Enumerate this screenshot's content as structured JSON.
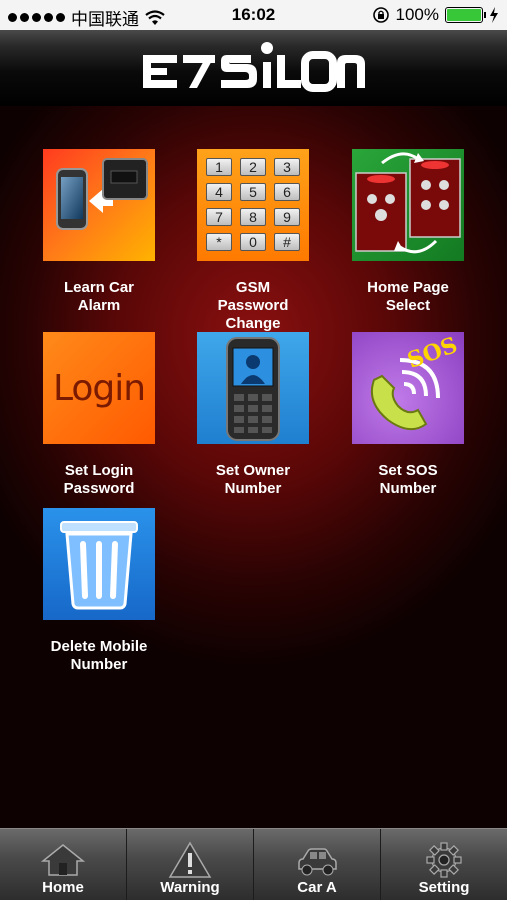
{
  "status_bar": {
    "carrier": "中国联通",
    "time": "16:02",
    "battery": "100%"
  },
  "header": {
    "logo_text": "EPSILON"
  },
  "tiles": [
    {
      "label_line1": "Learn Car",
      "label_line2": "Alarm",
      "icon": "learn-car-alarm-icon"
    },
    {
      "label_line1": "GSM",
      "label_line2": "Password",
      "label_line3": "Change",
      "icon": "keypad-icon"
    },
    {
      "label_line1": "Home Page",
      "label_line2": "Select",
      "icon": "home-page-select-icon"
    },
    {
      "label_line1": "Set Login",
      "label_line2": "Password",
      "icon": "login-icon",
      "icon_text": "Login"
    },
    {
      "label_line1": "Set Owner",
      "label_line2": "Number",
      "icon": "phone-owner-icon"
    },
    {
      "label_line1": "Set SOS",
      "label_line2": "Number",
      "icon": "sos-phone-icon",
      "icon_text": "SOS"
    },
    {
      "label_line1": "Delete Mobile",
      "label_line2": "Number",
      "icon": "trash-icon"
    }
  ],
  "keypad_keys": [
    "1",
    "2",
    "3",
    "4",
    "5",
    "6",
    "7",
    "8",
    "9",
    "*",
    "0",
    "#"
  ],
  "tabs": [
    {
      "label": "Home",
      "icon": "home-icon"
    },
    {
      "label": "Warning",
      "icon": "warning-icon"
    },
    {
      "label": "Car A",
      "icon": "car-icon"
    },
    {
      "label": "Setting",
      "icon": "gear-icon"
    }
  ],
  "colors": {
    "accent_red": "#8a1010",
    "battery_green": "#38c738",
    "tile_orange": "#ff7a00",
    "tile_blue": "#1f8fe0",
    "tile_purple": "#a24fd0",
    "tile_green": "#1f8a2a"
  }
}
